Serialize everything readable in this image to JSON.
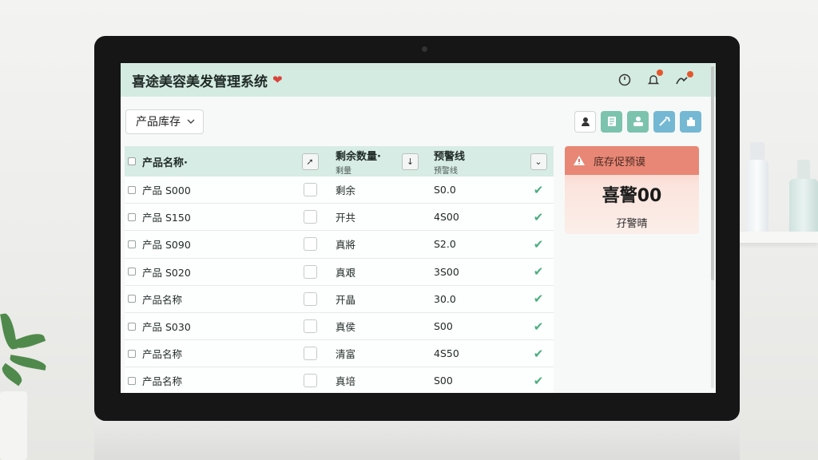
{
  "app": {
    "title": "喜途美容美发管理系统"
  },
  "toolbar": {
    "dropdown_value": "产品库存"
  },
  "table": {
    "headers": {
      "name": "产品名称·",
      "qty": "剩余数量·",
      "qty_sub": "剩量",
      "warn": "预警线",
      "warn_sub": "预警线"
    },
    "rows": [
      {
        "name": "产品 S000",
        "qty": "剩余",
        "warn": "S0.0"
      },
      {
        "name": "产品 S150",
        "qty": "开共",
        "warn": "4S00"
      },
      {
        "name": "产品 S090",
        "qty": "真將",
        "warn": "S2.0"
      },
      {
        "name": "产品 S020",
        "qty": "真艰",
        "warn": "3S00"
      },
      {
        "name": "产品名称",
        "qty": "开晶",
        "warn": "30.0"
      },
      {
        "name": "产品 S030",
        "qty": "真侯",
        "warn": "S00"
      },
      {
        "name": "产品名称",
        "qty": "清富",
        "warn": "4S50"
      },
      {
        "name": "产品名称",
        "qty": "真培",
        "warn": "S00"
      }
    ]
  },
  "alert": {
    "title": "底存促预谟",
    "big_text": "喜警00",
    "sub_text": "孖警晴"
  },
  "colors": {
    "header_bg": "#d4ebe1",
    "accent_teal": "#7cc3ae",
    "alert_red": "#e88775",
    "check_green": "#4cae7f"
  }
}
